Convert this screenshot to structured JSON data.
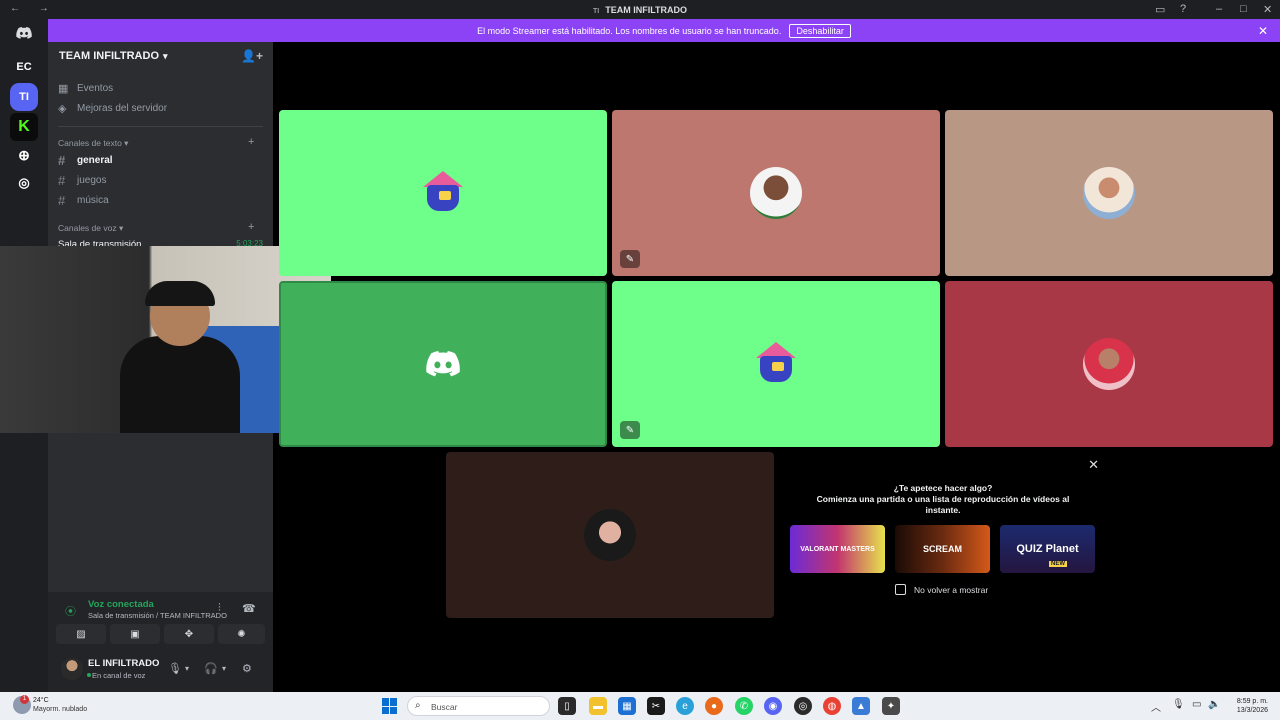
{
  "window": {
    "title": "TEAM INFILTRADO",
    "server_initials_small": "TI"
  },
  "banner": {
    "message": "El modo Streamer está habilitado. Los nombres de usuario se han truncado.",
    "button": "Deshabilitar"
  },
  "guilds": [
    {
      "name": "discord-home-icon"
    },
    {
      "label": "EC"
    },
    {
      "label": "TI"
    },
    {
      "name": "kick-server-icon"
    },
    {
      "name": "add-server-icon"
    },
    {
      "name": "discover-icon"
    }
  ],
  "server": {
    "name": "TEAM INFILTRADO",
    "events": "Eventos",
    "boosts": "Mejoras del servidor",
    "text_category": "Canales de texto",
    "text_channels": [
      "general",
      "juegos",
      "música"
    ],
    "voice_category": "Canales de voz",
    "voice_channel": "Sala de transmisión",
    "voice_timer": "5:03:23"
  },
  "voice_panel": {
    "status": "Voz conectada",
    "location": "Sala de transmisión / TEAM INFILTRADO"
  },
  "user": {
    "name": "EL INFILTRADO",
    "status": "En canal de voz"
  },
  "tiles_colors": {
    "green": "#6efe8a",
    "rose": "#bd776e",
    "tan": "#b99785",
    "greendark": "#41b05a",
    "crimson": "#a83846",
    "brown": "#2e1d19"
  },
  "suggest": {
    "question": "¿Te apetece hacer algo?",
    "description": "Comienza una partida o una lista de reproducción de vídeos al instante.",
    "cards": [
      "VALORANT MASTERS",
      "SCREAM",
      "QUIZ Planet"
    ],
    "card_new": "NEW",
    "checkbox_label": "No volver a mostrar"
  },
  "taskbar": {
    "weather_temp": "24°C",
    "weather_cond": "Mayorm. nublado",
    "weather_badge": "1",
    "search_placeholder": "Buscar",
    "time": "8:59 p. m.",
    "date": "13/3/2026"
  }
}
